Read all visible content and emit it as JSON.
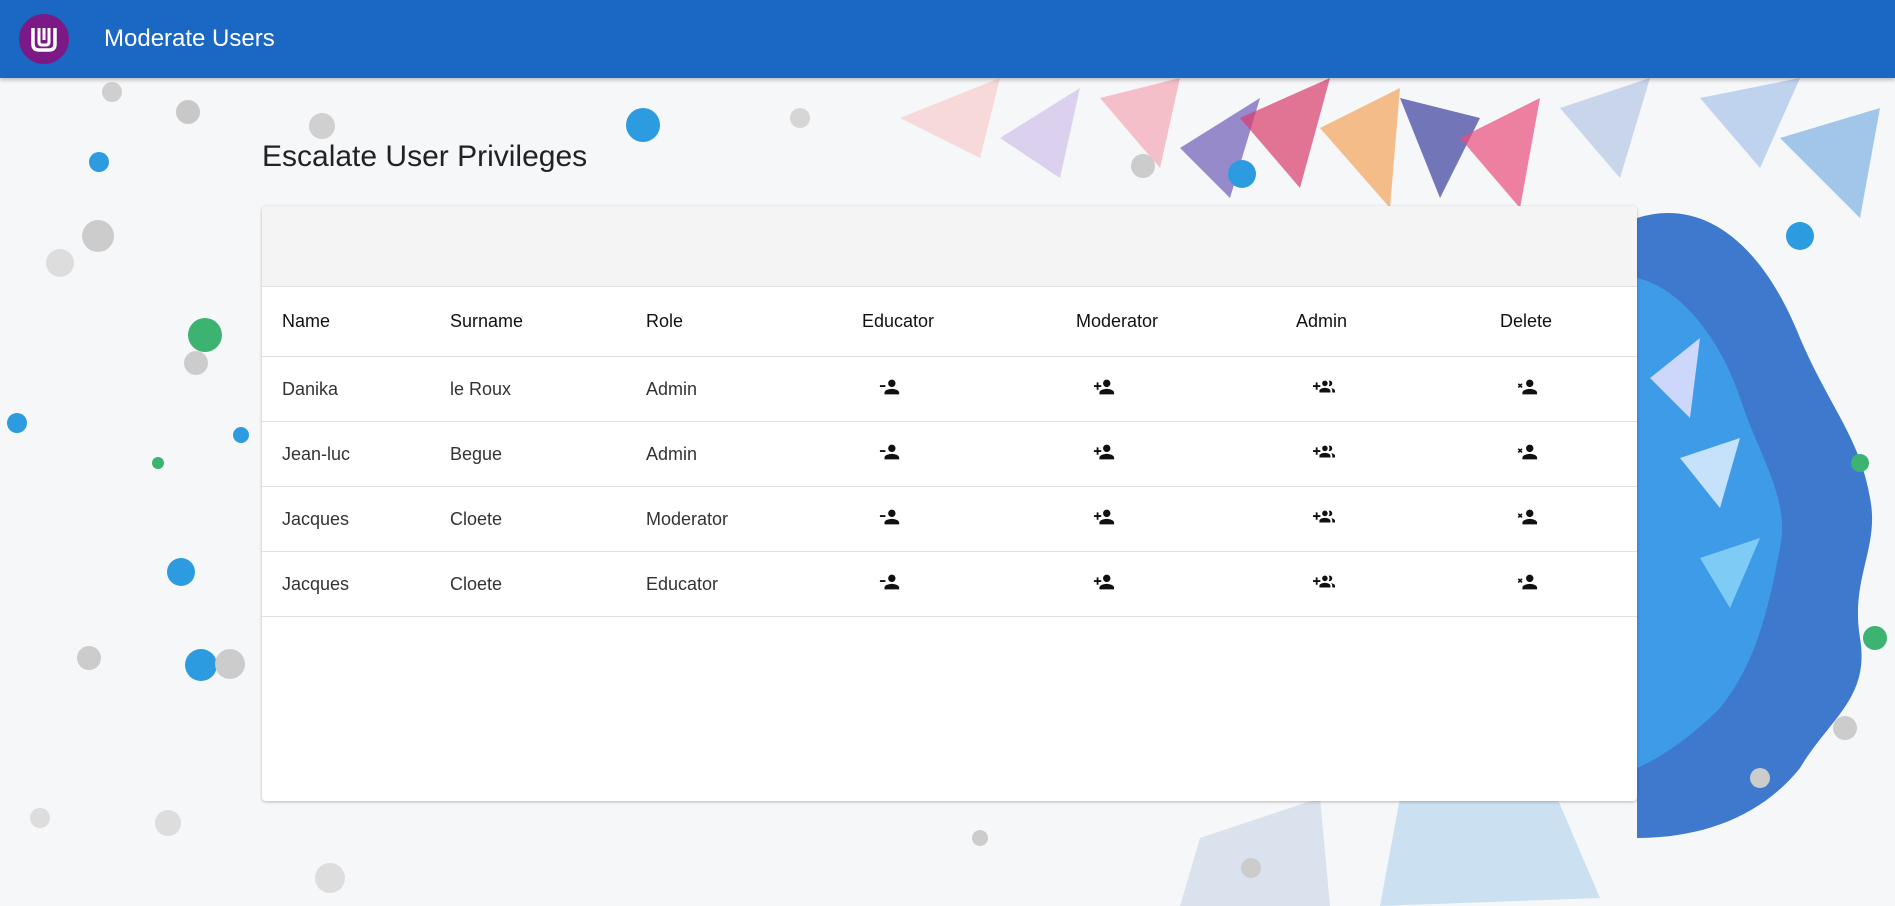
{
  "appbar": {
    "title": "Moderate Users",
    "logo_icon": "university-logo-icon",
    "color": "#1a67c4"
  },
  "page": {
    "title": "Escalate User Privileges"
  },
  "table": {
    "headers": {
      "name": "Name",
      "surname": "Surname",
      "role": "Role",
      "educator": "Educator",
      "moderator": "Moderator",
      "admin": "Admin",
      "delete": "Delete"
    },
    "rows": [
      {
        "name": "Danika",
        "surname": "le Roux",
        "role": "Admin"
      },
      {
        "name": "Jean-luc",
        "surname": "Begue",
        "role": "Admin"
      },
      {
        "name": "Jacques",
        "surname": "Cloete",
        "role": "Moderator"
      },
      {
        "name": "Jacques",
        "surname": "Cloete",
        "role": "Educator"
      }
    ],
    "action_icons": {
      "educator": "person-remove-icon",
      "moderator": "person-add-icon",
      "admin": "group-add-icon",
      "delete": "person-delete-icon"
    }
  }
}
